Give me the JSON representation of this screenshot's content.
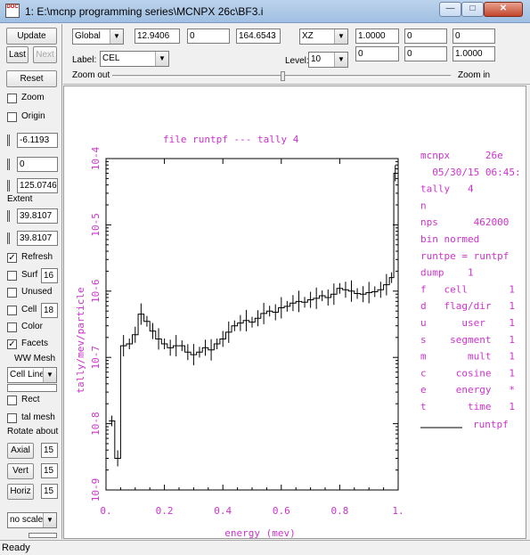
{
  "window": {
    "title": "1:  E:\\mcnp programming series\\MCNPX 26c\\BF3.i",
    "icon_label": "DOC"
  },
  "left": {
    "update": "Update",
    "last": "Last",
    "next": "Next",
    "reset": "Reset",
    "zoom": "Zoom",
    "origin": "Origin",
    "origin_vals": [
      "-6.1193",
      "0",
      "125.0746"
    ],
    "extent_label": "Extent",
    "extent_vals": [
      "39.8107",
      "39.8107"
    ],
    "refresh": {
      "label": "Refresh",
      "checked": true
    },
    "surf": {
      "label": "Surf",
      "value": "16"
    },
    "unused": "Unused",
    "cell": {
      "label": "Cell",
      "value": "18"
    },
    "color": "Color",
    "facets": {
      "label": "Facets",
      "checked": true
    },
    "wwmesh": "WW Mesh",
    "cellline": "Cell Line",
    "rect": "Rect",
    "talmesh": "tal mesh",
    "rotate_about": "Rotate about",
    "axial": {
      "label": "Axial",
      "value": "15"
    },
    "vert": {
      "label": "Vert",
      "value": "15"
    },
    "horiz": {
      "label": "Horiz",
      "value": "15"
    },
    "scale": "no scale"
  },
  "toolbar": {
    "coord": "Global",
    "origin_vals": [
      "12.9406",
      "0",
      "164.6543"
    ],
    "plane": "XZ",
    "basis_row1": [
      "1.0000",
      "0",
      "0"
    ],
    "basis_row2": [
      "0",
      "0",
      "1.0000"
    ],
    "label_caption": "Label:",
    "label_value": "CEL",
    "level_caption": "Level:",
    "level_value": "10",
    "zoom_out": "Zoom out",
    "zoom_in": "Zoom in"
  },
  "chart_data": {
    "type": "line",
    "title": "file runtpf   --- tally    4",
    "xlabel": "energy (mev)",
    "ylabel": "tally/mev/particle",
    "xlim": [
      0,
      1
    ],
    "ylim_log10": [
      -9,
      -4
    ],
    "y_scale": "log",
    "xticks": [
      "0.",
      "0.2",
      "0.4",
      "0.6",
      "0.8",
      "1."
    ],
    "yticks": [
      "10-9",
      "10-8",
      "10-7",
      "10-6",
      "10-5",
      "10-4"
    ],
    "series": [
      {
        "x": [
          0.02,
          0.04,
          0.06,
          0.08,
          0.1,
          0.12,
          0.14,
          0.16,
          0.18,
          0.2,
          0.22,
          0.24,
          0.26,
          0.28,
          0.3,
          0.32,
          0.34,
          0.36,
          0.38,
          0.4,
          0.42,
          0.44,
          0.46,
          0.48,
          0.5,
          0.52,
          0.54,
          0.56,
          0.58,
          0.6,
          0.62,
          0.64,
          0.66,
          0.68,
          0.7,
          0.72,
          0.74,
          0.76,
          0.78,
          0.8,
          0.82,
          0.84,
          0.86,
          0.88,
          0.9,
          0.92,
          0.94,
          0.96,
          0.98,
          0.99
        ],
        "y": [
          1.1e-08,
          3e-09,
          1.5e-07,
          1.6e-07,
          2.2e-07,
          4.5e-07,
          3.5e-07,
          2.5e-07,
          1.9e-07,
          1.6e-07,
          1.4e-07,
          1.5e-07,
          1.5e-07,
          1.2e-07,
          1.1e-07,
          1.2e-07,
          1.4e-07,
          1.3e-07,
          1.6e-07,
          1.9e-07,
          2.4e-07,
          3e-07,
          3.3e-07,
          3.6e-07,
          3.4e-07,
          3.9e-07,
          4.6e-07,
          5e-07,
          4.8e-07,
          5.6e-07,
          5.9e-07,
          6.6e-07,
          7e-07,
          6.8e-07,
          7.4e-07,
          7.8e-07,
          8.5e-07,
          8e-07,
          9e-07,
          1.1e-06,
          1.05e-06,
          1e-06,
          9.2e-07,
          9e-07,
          9.5e-07,
          9.8e-07,
          1.05e-06,
          1.25e-06,
          1.6e-06,
          6e-05
        ]
      }
    ],
    "info_lines": [
      "mcnpx      26e",
      "  05/30/15 06:45:",
      "tally   4",
      "n",
      "nps      462000",
      "bin normed",
      "runtpe = runtpf",
      "dump    1",
      "f   cell       1",
      "d   flag/dir   1",
      "u      user    1",
      "s    segment   1",
      "m       mult   1",
      "c     cosine   1",
      "e     energy   *",
      "t       time   1"
    ],
    "legend_label": "runtpf",
    "line_color": "#000000",
    "text_color": "#cc33cc"
  },
  "status": "Ready"
}
